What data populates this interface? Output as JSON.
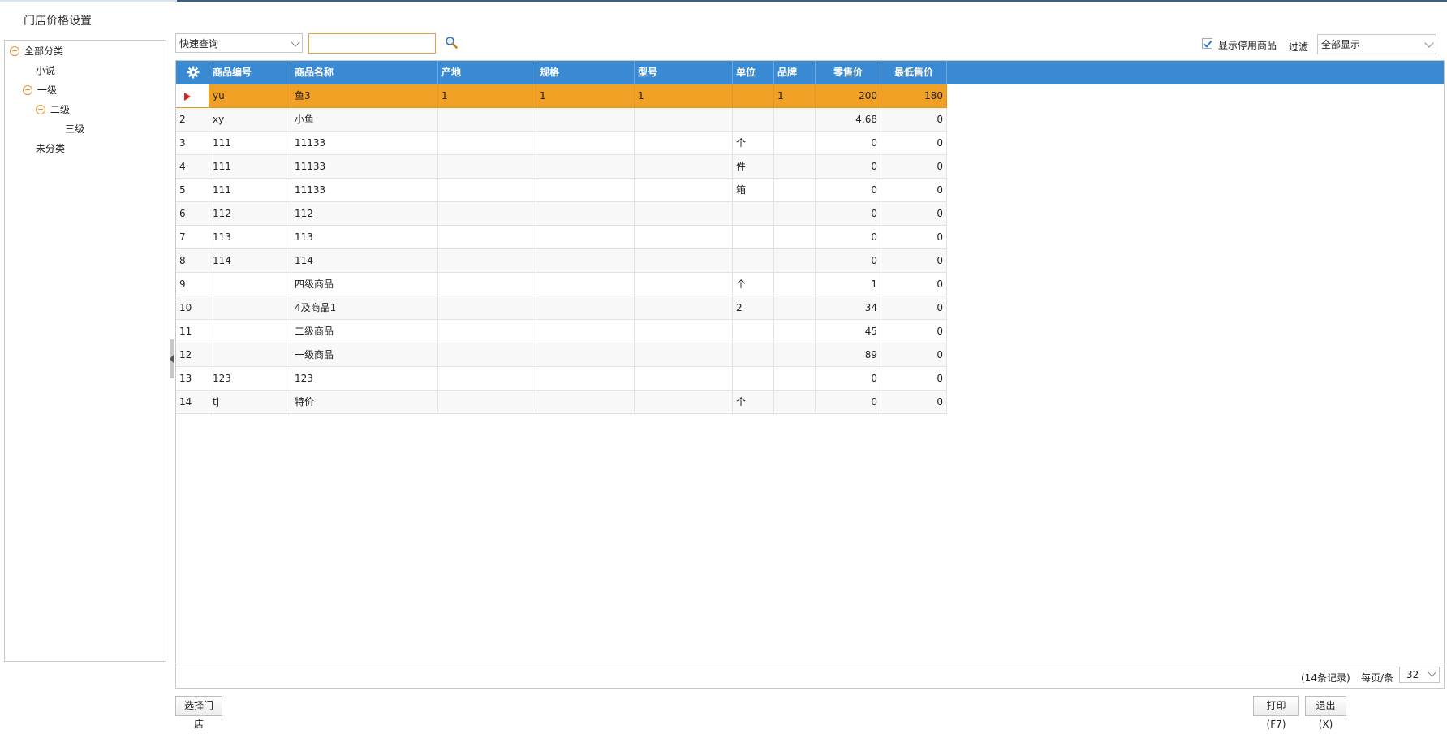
{
  "page_title": "门店价格设置",
  "tree": {
    "nodes": [
      {
        "label": "全部分类",
        "expanded": true
      },
      {
        "label": "小说"
      },
      {
        "label": "一级",
        "expanded": true
      },
      {
        "label": "二级",
        "expanded": true
      },
      {
        "label": "三级"
      },
      {
        "label": "未分类"
      }
    ]
  },
  "toolbar": {
    "query_type": "快速查询",
    "search_value": "",
    "show_disabled_label": "显示停用商品",
    "show_disabled_checked": true,
    "filter_label": "过滤",
    "filter_value": "全部显示"
  },
  "grid": {
    "columns": [
      "商品编号",
      "商品名称",
      "产地",
      "规格",
      "型号",
      "单位",
      "品牌",
      "零售价",
      "最低售价"
    ],
    "rows": [
      {
        "no": "1",
        "code": "yu",
        "name": "鱼3",
        "origin": "1",
        "spec": "1",
        "model": "1",
        "unit": "",
        "brand": "1",
        "retail": "200",
        "min": "180",
        "selected": true
      },
      {
        "no": "2",
        "code": "xy",
        "name": "小鱼",
        "origin": "",
        "spec": "",
        "model": "",
        "unit": "",
        "brand": "",
        "retail": "4.68",
        "min": "0"
      },
      {
        "no": "3",
        "code": "111",
        "name": "11133",
        "origin": "",
        "spec": "",
        "model": "",
        "unit": "个",
        "brand": "",
        "retail": "0",
        "min": "0"
      },
      {
        "no": "4",
        "code": "111",
        "name": "11133",
        "origin": "",
        "spec": "",
        "model": "",
        "unit": "件",
        "brand": "",
        "retail": "0",
        "min": "0"
      },
      {
        "no": "5",
        "code": "111",
        "name": "11133",
        "origin": "",
        "spec": "",
        "model": "",
        "unit": "箱",
        "brand": "",
        "retail": "0",
        "min": "0"
      },
      {
        "no": "6",
        "code": "112",
        "name": "112",
        "origin": "",
        "spec": "",
        "model": "",
        "unit": "",
        "brand": "",
        "retail": "0",
        "min": "0"
      },
      {
        "no": "7",
        "code": "113",
        "name": "113",
        "origin": "",
        "spec": "",
        "model": "",
        "unit": "",
        "brand": "",
        "retail": "0",
        "min": "0"
      },
      {
        "no": "8",
        "code": "114",
        "name": "114",
        "origin": "",
        "spec": "",
        "model": "",
        "unit": "",
        "brand": "",
        "retail": "0",
        "min": "0"
      },
      {
        "no": "9",
        "code": "",
        "name": "四级商品",
        "origin": "",
        "spec": "",
        "model": "",
        "unit": "个",
        "brand": "",
        "retail": "1",
        "min": "0"
      },
      {
        "no": "10",
        "code": "",
        "name": "4及商品1",
        "origin": "",
        "spec": "",
        "model": "",
        "unit": "2",
        "brand": "",
        "retail": "34",
        "min": "0"
      },
      {
        "no": "11",
        "code": "",
        "name": "二级商品",
        "origin": "",
        "spec": "",
        "model": "",
        "unit": "",
        "brand": "",
        "retail": "45",
        "min": "0"
      },
      {
        "no": "12",
        "code": "",
        "name": "一级商品",
        "origin": "",
        "spec": "",
        "model": "",
        "unit": "",
        "brand": "",
        "retail": "89",
        "min": "0"
      },
      {
        "no": "13",
        "code": "123",
        "name": "123",
        "origin": "",
        "spec": "",
        "model": "",
        "unit": "",
        "brand": "",
        "retail": "0",
        "min": "0"
      },
      {
        "no": "14",
        "code": "tj",
        "name": "特价",
        "origin": "",
        "spec": "",
        "model": "",
        "unit": "个",
        "brand": "",
        "retail": "0",
        "min": "0"
      }
    ]
  },
  "pager": {
    "records_text": "(14条记录)",
    "per_page_label": "每页/条",
    "per_page_value": "32"
  },
  "buttons": {
    "select_store": "选择门店",
    "print": "打印(F7)",
    "exit": "退出(X)"
  },
  "colors": {
    "header_blue": "#3a8ad3",
    "selected_row": "#f0a024",
    "tree_toggle": "#e8902a"
  }
}
